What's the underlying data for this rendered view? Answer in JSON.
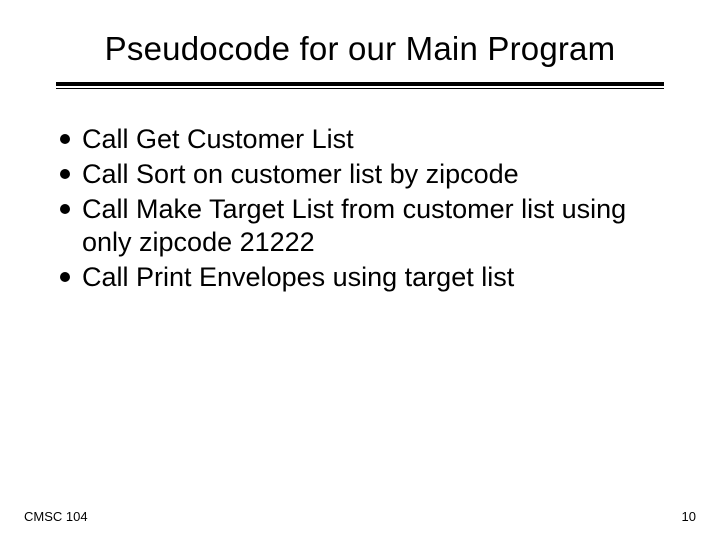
{
  "title": "Pseudocode for our Main Program",
  "bullets": [
    "Call Get Customer List",
    "Call Sort on customer list by zipcode",
    "Call Make Target List from customer list using only zipcode 21222",
    "Call Print Envelopes using target list"
  ],
  "footer": {
    "left": "CMSC 104",
    "right": "10"
  }
}
